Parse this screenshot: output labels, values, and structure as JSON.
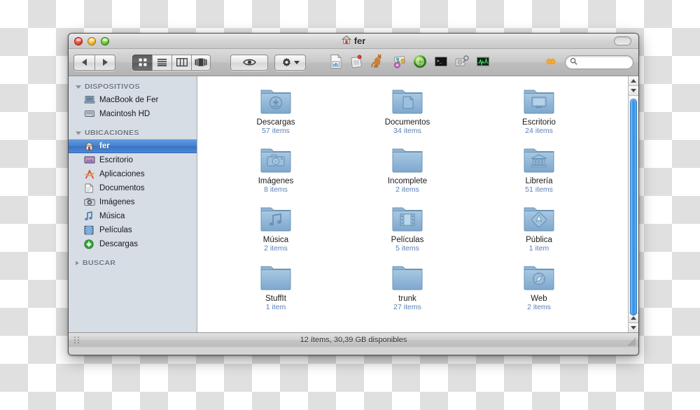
{
  "window": {
    "title": "fer",
    "title_icon": "home-icon",
    "traffic_lights": [
      "close-button",
      "minimize-button",
      "zoom-button"
    ]
  },
  "toolbar": {
    "back_label": "◀",
    "forward_label": "▶",
    "view_modes": [
      {
        "name": "icon-view",
        "label": "Icon View",
        "active": true
      },
      {
        "name": "list-view",
        "label": "List View",
        "active": false
      },
      {
        "name": "column-view",
        "label": "Column View",
        "active": false
      },
      {
        "name": "coverflow-view",
        "label": "Cover Flow View",
        "active": false
      }
    ],
    "quicklook_label": "Quick Look",
    "action_label": "Action",
    "app_shortcuts": [
      {
        "name": "numbers-document-icon",
        "label": "Numbers Document"
      },
      {
        "name": "snapshot-app-icon",
        "label": "Snapshot"
      },
      {
        "name": "kangaroo-app-icon",
        "label": "Kangaroo"
      },
      {
        "name": "photo-album-icon",
        "label": "Photo Album"
      },
      {
        "name": "green-sphere-app-icon",
        "label": "Green Sphere"
      },
      {
        "name": "terminal-icon",
        "label": "Terminal"
      },
      {
        "name": "disk-utility-icon",
        "label": "Disk Utility"
      },
      {
        "name": "activity-monitor-icon",
        "label": "Activity Monitor"
      }
    ],
    "cloud_icon_label": "Infinity",
    "search_placeholder": "",
    "search_value": ""
  },
  "sidebar": {
    "sections": [
      {
        "name": "dispositivos",
        "header": "DISPOSITIVOS",
        "expanded": true,
        "items": [
          {
            "name": "macbook-de-fer",
            "label": "MacBook de Fer",
            "icon": "laptop-icon",
            "selected": false
          },
          {
            "name": "macintosh-hd",
            "label": "Macintosh HD",
            "icon": "harddisk-icon",
            "selected": false
          }
        ]
      },
      {
        "name": "ubicaciones",
        "header": "UBICACIONES",
        "expanded": true,
        "items": [
          {
            "name": "fer",
            "label": "fer",
            "icon": "home-icon",
            "selected": true
          },
          {
            "name": "escritorio",
            "label": "Escritorio",
            "icon": "desktop-icon",
            "selected": false
          },
          {
            "name": "aplicaciones",
            "label": "Aplicaciones",
            "icon": "applications-icon",
            "selected": false
          },
          {
            "name": "documentos",
            "label": "Documentos",
            "icon": "documents-icon",
            "selected": false
          },
          {
            "name": "imagenes",
            "label": "Imágenes",
            "icon": "camera-icon",
            "selected": false
          },
          {
            "name": "musica",
            "label": "Música",
            "icon": "music-note-icon",
            "selected": false
          },
          {
            "name": "peliculas",
            "label": "Películas",
            "icon": "film-icon",
            "selected": false
          },
          {
            "name": "descargas",
            "label": "Descargas",
            "icon": "download-icon",
            "selected": false
          }
        ]
      },
      {
        "name": "buscar",
        "header": "BUSCAR",
        "expanded": false,
        "items": []
      }
    ]
  },
  "content": {
    "files": [
      {
        "name": "descargas",
        "label": "Descargas",
        "count": "57 items",
        "icon": "folder-download-icon"
      },
      {
        "name": "documentos",
        "label": "Documentos",
        "count": "34 items",
        "icon": "folder-document-icon"
      },
      {
        "name": "escritorio",
        "label": "Escritorio",
        "count": "24 items",
        "icon": "folder-desktop-icon"
      },
      {
        "name": "imagenes",
        "label": "Imágenes",
        "count": "8 items",
        "icon": "folder-camera-icon"
      },
      {
        "name": "incomplete",
        "label": "Incomplete",
        "count": "2 items",
        "icon": "folder-plain-icon"
      },
      {
        "name": "libreria",
        "label": "Librería",
        "count": "51 items",
        "icon": "folder-library-icon"
      },
      {
        "name": "musica",
        "label": "Música",
        "count": "2 items",
        "icon": "folder-music-icon"
      },
      {
        "name": "peliculas",
        "label": "Películas",
        "count": "5 items",
        "icon": "folder-film-icon"
      },
      {
        "name": "publica",
        "label": "Pública",
        "count": "1 item",
        "icon": "folder-public-icon"
      },
      {
        "name": "stuffit",
        "label": "StuffIt",
        "count": "1 item",
        "icon": "folder-plain-icon"
      },
      {
        "name": "trunk",
        "label": "trunk",
        "count": "27 items",
        "icon": "folder-plain-icon"
      },
      {
        "name": "web",
        "label": "Web",
        "count": "2 items",
        "icon": "folder-safari-icon"
      }
    ]
  },
  "statusbar": {
    "text": "12 ítems, 30,39 GB disponibles"
  },
  "colors": {
    "selection_blue": "#4480cd",
    "sidebar_bg": "#d7dde5",
    "folder_blue": "#7ba7cc",
    "count_text": "#5a7fb5",
    "scrollbar_blue": "#2e90e8"
  }
}
